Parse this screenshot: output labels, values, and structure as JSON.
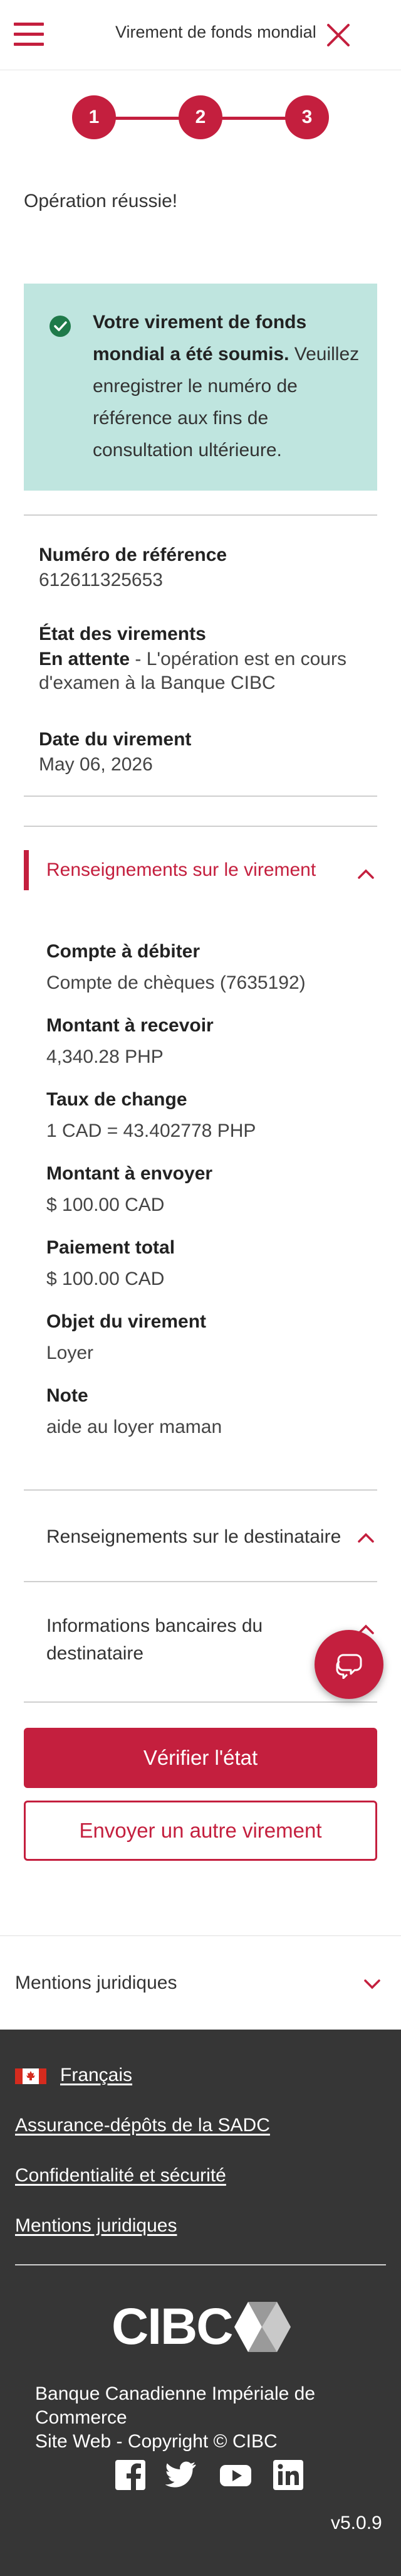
{
  "header": {
    "title": "Virement de fonds mondial",
    "menu_icon": "hamburger-menu-icon",
    "close_icon": "close-icon"
  },
  "stepper": {
    "steps": [
      "1",
      "2",
      "3"
    ],
    "current": 3
  },
  "success_message": "Opération réussie!",
  "alert": {
    "bold": "Votre virement de fonds mondial a été soumis.",
    "text": " Veuillez enregistrer le numéro de référence aux fins de consultation ultérieure.",
    "icon": "check-circle-icon"
  },
  "summary": {
    "reference_label": "Numéro de référence",
    "reference_value": "612611325653",
    "status_label": "État des virements",
    "status_bold": "En attente",
    "status_text": " - L'opération est en cours d'examen à la Banque CIBC",
    "date_label": "Date du virement",
    "date_value": "May 06, 2026"
  },
  "transfer_details": {
    "title": "Renseignements sur le virement",
    "fields": [
      {
        "label": "Compte à débiter",
        "value": "Compte de chèques (7635192)"
      },
      {
        "label": "Montant à recevoir",
        "value": "4,340.28 PHP"
      },
      {
        "label": "Taux de change",
        "value": "1 CAD = 43.402778 PHP"
      },
      {
        "label": "Montant à envoyer",
        "value": "$ 100.00 CAD"
      },
      {
        "label": "Paiement total",
        "value": "$ 100.00 CAD"
      },
      {
        "label": "Objet du virement",
        "value": "Loyer"
      },
      {
        "label": "Note",
        "value": "aide au loyer maman"
      }
    ]
  },
  "recipient_section": {
    "title": "Renseignements sur le destinataire"
  },
  "bank_section": {
    "title": "Informations bancaires du destinataire"
  },
  "buttons": {
    "check_status": "Vérifier l'état",
    "send_another": "Envoyer un autre virement"
  },
  "legal_bar": {
    "title": "Mentions juridiques"
  },
  "footer": {
    "language": "Français",
    "links": [
      "Assurance-dépôts de la SADC",
      "Confidentialité et sécurité",
      "Mentions juridiques"
    ],
    "logo_text": "CIBC",
    "bank_name": "Banque Canadienne Impériale de Commerce",
    "copyright": "Site Web - Copyright © CIBC",
    "social": [
      "facebook-icon",
      "twitter-icon",
      "youtube-icon",
      "linkedin-icon"
    ],
    "version": "v5.0.9"
  },
  "colors": {
    "accent": "#c41f3e",
    "alert_bg": "#bfe5df",
    "footer_bg": "#363636",
    "success_icon": "#1f7a4a"
  }
}
